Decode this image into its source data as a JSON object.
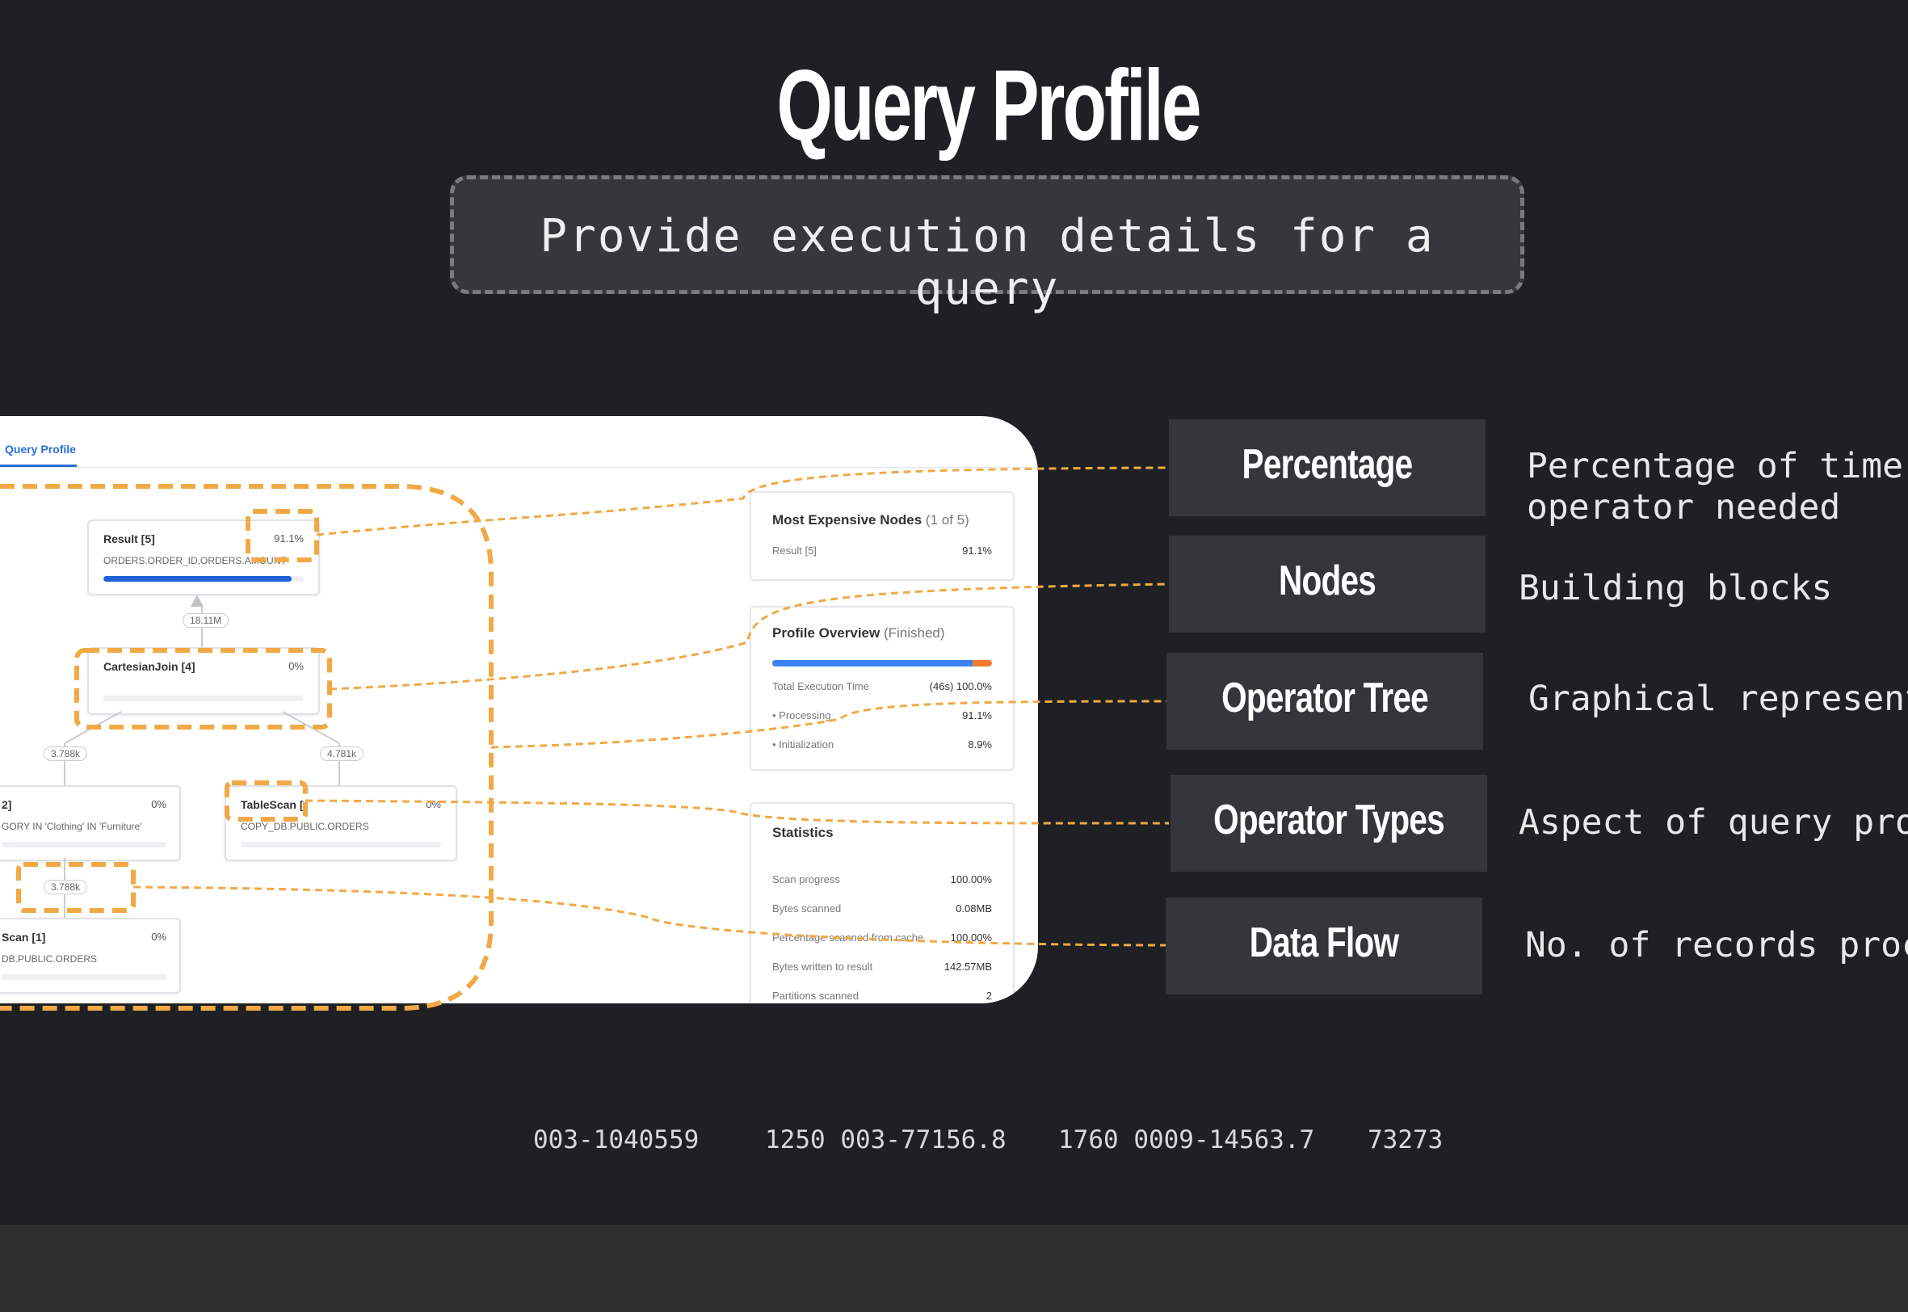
{
  "header": {
    "title": "Query Profile",
    "subtitle": "Provide execution details for a query"
  },
  "screenshot": {
    "tab_label": "Query Profile",
    "nodes": [
      {
        "name": "Result [5]",
        "percent": "91.1%",
        "detail": "ORDERS.ORDER_ID,ORDERS.AMOUNT",
        "progress": 0.94
      },
      {
        "name": "CartesianJoin [4]",
        "percent": "0%",
        "detail": "",
        "progress": 0
      },
      {
        "name": "2]",
        "percent": "0%",
        "detail": "GORY IN 'Clothing' IN 'Furniture'",
        "progress": 0
      },
      {
        "name": "TableScan [",
        "percent": "0%",
        "detail": "COPY_DB.PUBLIC.ORDERS",
        "progress": 0
      },
      {
        "name": "Scan [1]",
        "percent": "0%",
        "detail": "DB.PUBLIC.ORDERS",
        "progress": 0
      }
    ],
    "edge_labels": [
      "18.11M",
      "3.788k",
      "4.781k",
      "3.788k"
    ],
    "expensive_nodes": {
      "title": "Most Expensive Nodes",
      "count": "(1 of 5)",
      "rows": [
        {
          "label": "Result [5]",
          "value": "91.1%"
        }
      ]
    },
    "profile_overview": {
      "title": "Profile Overview",
      "status": "(Finished)",
      "rows": [
        {
          "label": "Total Execution Time",
          "value": "(46s) 100.0%"
        },
        {
          "label": "• Processing",
          "value": "91.1%"
        },
        {
          "label": "• Initialization",
          "value": "8.9%"
        }
      ],
      "processing_fraction": 0.911,
      "colors": {
        "processing": "#3b82f6",
        "initialization": "#f07c2c"
      }
    },
    "statistics": {
      "title": "Statistics",
      "rows": [
        {
          "label": "Scan progress",
          "value": "100.00%"
        },
        {
          "label": "Bytes scanned",
          "value": "0.08MB"
        },
        {
          "label": "Percentage scanned from cache",
          "value": "100.00%"
        },
        {
          "label": "Bytes written to result",
          "value": "142.57MB"
        },
        {
          "label": "Partitions scanned",
          "value": "2"
        }
      ]
    }
  },
  "callouts": [
    {
      "label": "Percentage",
      "description": [
        "Percentage of time",
        "operator needed"
      ]
    },
    {
      "label": "Nodes",
      "description": [
        "Building blocks"
      ]
    },
    {
      "label": "Operator Tree",
      "description": [
        "Graphical represent"
      ]
    },
    {
      "label": "Operator Types",
      "description": [
        "Aspect of query pro"
      ]
    },
    {
      "label": "Data Flow",
      "description": [
        "No. of records proc"
      ]
    }
  ],
  "footer": [
    "003-1040559",
    "1250 003-77156.8",
    "1760 0009-14563.7",
    "73273"
  ],
  "colors": {
    "highlight": "#f0a945",
    "background": "#1f2023",
    "label_bg": "#35363a",
    "accent_blue": "#2b6fd6"
  }
}
